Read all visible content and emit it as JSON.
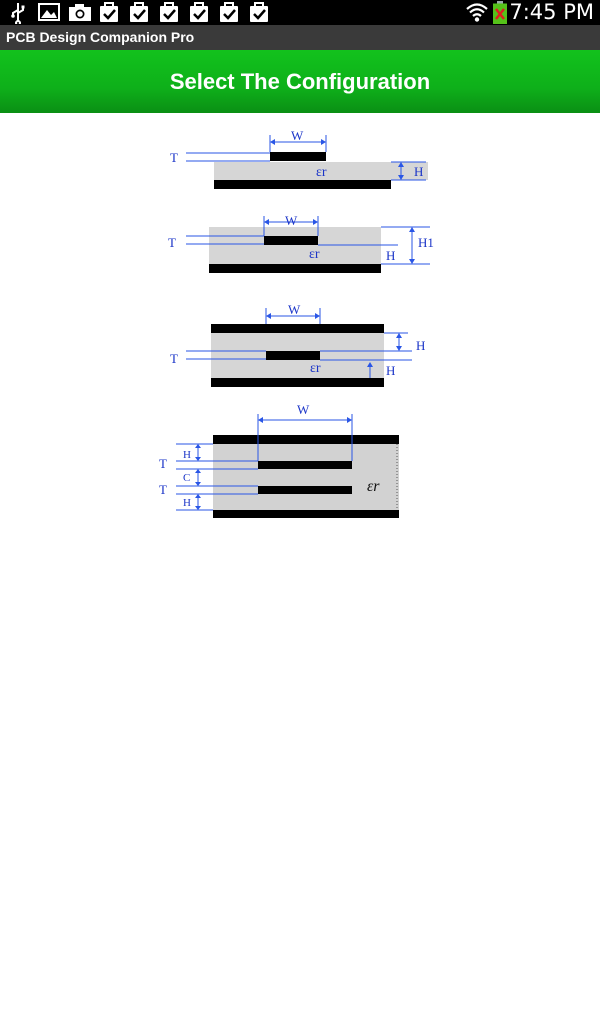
{
  "status_bar": {
    "time": "7:45 PM",
    "left_icons": [
      "usb-icon",
      "gallery-icon",
      "camera-icon",
      "task-check-icon",
      "task-check-icon",
      "task-check-icon",
      "task-check-icon",
      "task-check-icon",
      "task-check-icon"
    ],
    "right_icons": [
      "wifi-icon",
      "battery-icon"
    ]
  },
  "app": {
    "title": "PCB Design Companion Pro"
  },
  "header": {
    "title": "Select The Configuration",
    "color": "#0eb01a"
  },
  "configs": [
    {
      "name": "microstrip",
      "labels": {
        "w": "W",
        "t": "T",
        "er": "εr",
        "h": "H"
      }
    },
    {
      "name": "embedded-microstrip",
      "labels": {
        "w": "W",
        "t": "T",
        "er": "εr",
        "h": "H",
        "h1": "H1"
      }
    },
    {
      "name": "symmetric-stripline",
      "labels": {
        "w": "W",
        "t": "T",
        "er": "εr",
        "h": "H",
        "h2": "H"
      }
    },
    {
      "name": "dual-stripline",
      "labels": {
        "w": "W",
        "t1": "T",
        "t2": "T",
        "c": "C",
        "h1": "H",
        "h2": "H",
        "er": "εr"
      }
    }
  ]
}
